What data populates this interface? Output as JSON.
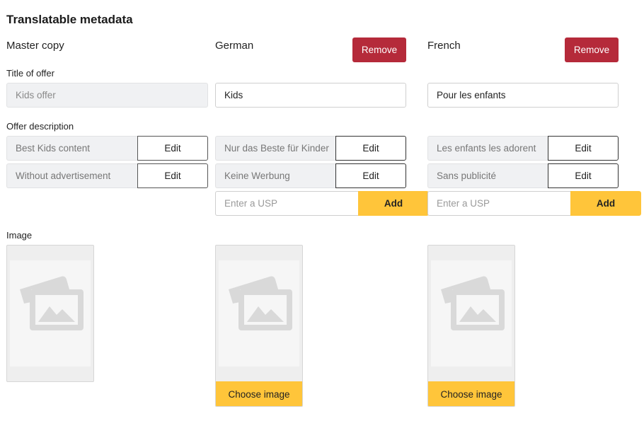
{
  "page": {
    "title": "Translatable metadata"
  },
  "labels": {
    "title_of_offer": "Title of offer",
    "offer_description": "Offer description",
    "image": "Image"
  },
  "master": {
    "heading": "Master copy",
    "title_value": "Kids offer",
    "usps": [
      "Best Kids content",
      "Without advertisement"
    ],
    "edit_label": "Edit"
  },
  "german": {
    "heading": "German",
    "remove_label": "Remove",
    "title_value": "Kids",
    "usps": [
      "Nur das Beste für Kinder",
      "Keine Werbung"
    ],
    "edit_label": "Edit",
    "usp_placeholder": "Enter a USP",
    "add_label": "Add",
    "choose_image_label": "Choose image"
  },
  "french": {
    "heading": "French",
    "remove_label": "Remove",
    "title_value": "Pour les enfants",
    "usps": [
      "Les enfants les adorent",
      "Sans publicité"
    ],
    "edit_label": "Edit",
    "usp_placeholder": "Enter a USP",
    "add_label": "Add",
    "choose_image_label": "Choose image"
  },
  "icons": {
    "image_placeholder": "image-placeholder-icon"
  },
  "colors": {
    "remove": "#b52a3a",
    "accent": "#ffc53a",
    "readonly_bg": "#f0f1f3"
  }
}
